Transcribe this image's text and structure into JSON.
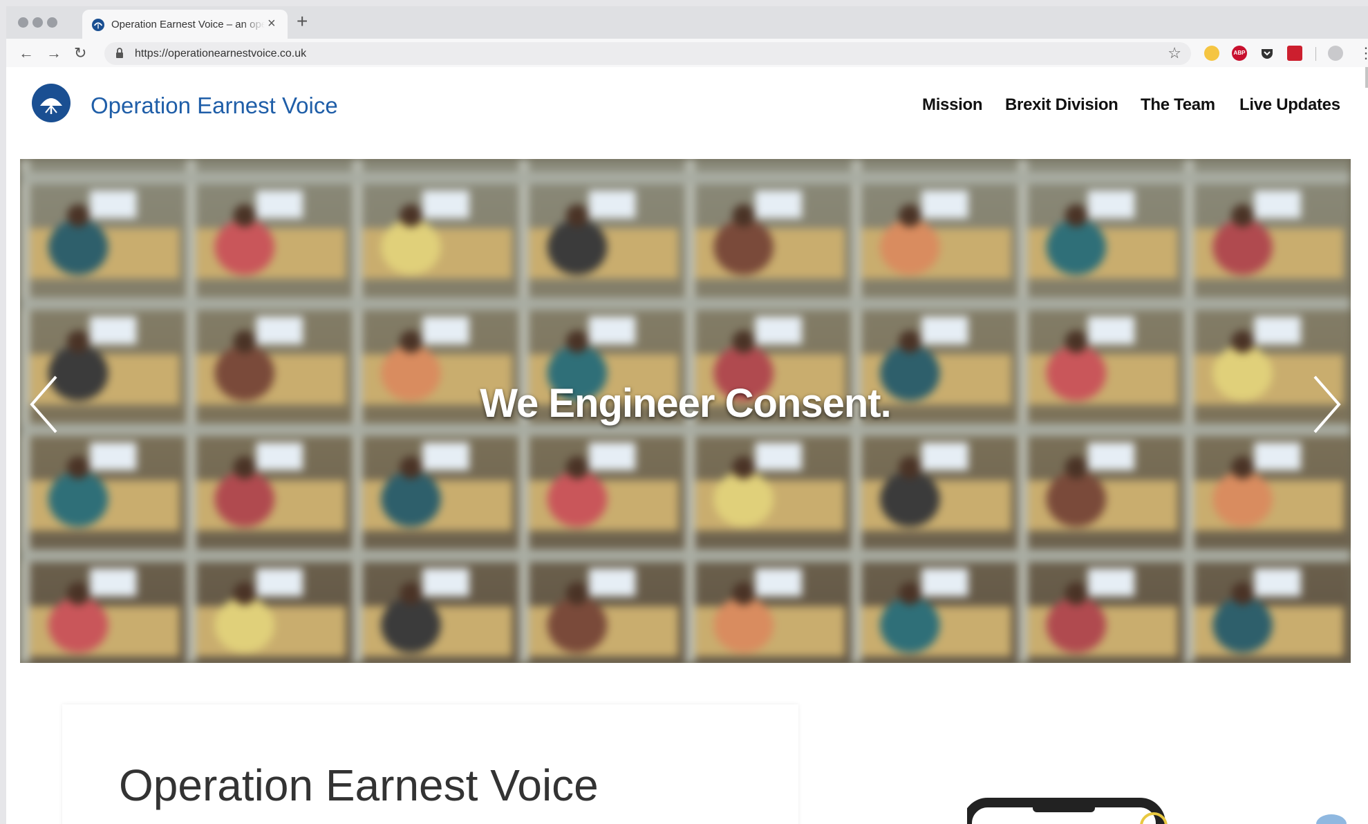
{
  "browser": {
    "tab_title": "Operation Earnest Voice – an operation",
    "tab_close": "×",
    "new_tab": "+",
    "url": "https://operationearnestvoice.co.uk",
    "back": "←",
    "forward": "→",
    "reload": "↻",
    "bookmark": "☆",
    "menu": "⋮",
    "extensions": [
      "emoji-extension-icon",
      "adblock-plus-icon",
      "pocket-icon",
      "lastpass-icon",
      "profile-avatar-icon"
    ],
    "extension_labels": {
      "adblock": "ABP"
    }
  },
  "site": {
    "brand": "Operation Earnest Voice",
    "brand_color": "#1f5ea8",
    "nav": [
      {
        "label": "Mission"
      },
      {
        "label": "Brexit Division"
      },
      {
        "label": "The Team"
      },
      {
        "label": "Live Updates"
      }
    ]
  },
  "hero": {
    "caption": "We Engineer Consent.",
    "prev_icon": "chevron-left-icon",
    "next_icon": "chevron-right-icon"
  },
  "intro": {
    "heading": "Operation Earnest Voice"
  }
}
